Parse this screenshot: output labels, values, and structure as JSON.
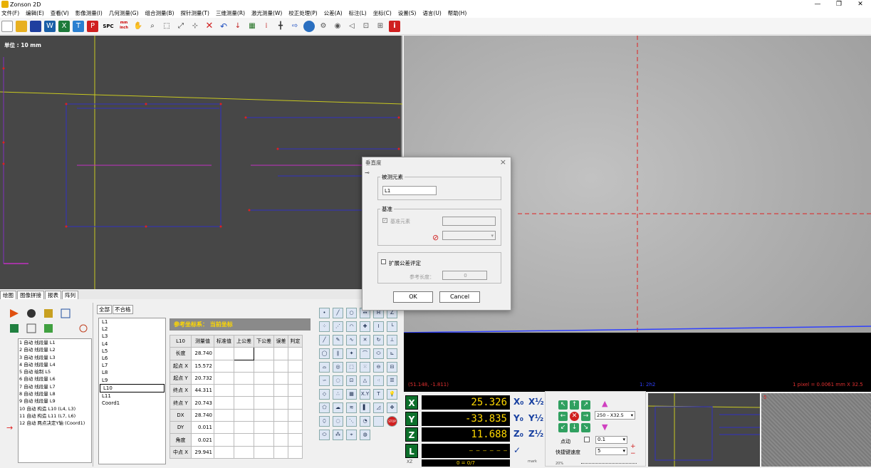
{
  "app": {
    "title": "Zonson 2D",
    "minimize": "—",
    "maximize": "❐",
    "close": "✕"
  },
  "menu": [
    "文件(F)",
    "编辑(E)",
    "查看(V)",
    "影像测量(I)",
    "几何测量(G)",
    "组合测量(B)",
    "探针测量(T)",
    "三维测量(R)",
    "激光测量(W)",
    "校正处理(P)",
    "公差(A)",
    "标注(L)",
    "坐标(C)",
    "设置(S)",
    "语言(U)",
    "帮助(H)"
  ],
  "toolbar": {
    "spc": "SPC",
    "mm_inch": "mm inch"
  },
  "left_view": {
    "unit": "单位 : 10 mm"
  },
  "camera": {
    "coord_readout": "(51.148, -1.811)",
    "blue_text": "1: 2h2",
    "pixel_readout": "1 pixel = 0.0061 mm   X 32.5"
  },
  "tabs": [
    "绘图",
    "图像拼接",
    "报表",
    "阵列"
  ],
  "program": {
    "steps": [
      "1 自动 线段量 L1",
      "2 自动 线段量 L2",
      "3 自动 线段量 L3",
      "4 自动 线段量 L4",
      "5 自动 绘制 L5",
      "6 自动 线段量 L6",
      "7 自动 线段量 L7",
      "8 自动 线段量 L8",
      "9 自动 线段量 L9",
      "10 自动 构造 L10 (L4, L3)",
      "11 自动 构造 L11 (L7, L6)",
      "12 自动 两点决定Y轴 (Coord1)"
    ]
  },
  "elements": {
    "tabs": [
      "全部",
      "不合格"
    ],
    "items": [
      "L1",
      "L2",
      "L3",
      "L4",
      "L5",
      "L6",
      "L7",
      "L8",
      "L9",
      "L10",
      "L11",
      "Coord1"
    ],
    "selected": "L10"
  },
  "measure": {
    "ref_label": "参考坐标系：   当前坐标",
    "element": "L10",
    "headers": [
      "测量值",
      "标准值",
      "上公差",
      "下公差",
      "误差",
      "判定"
    ],
    "rows": [
      {
        "name": "长度",
        "value": "28.740"
      },
      {
        "name": "起点 X",
        "value": "15.572"
      },
      {
        "name": "起点 Y",
        "value": "20.732"
      },
      {
        "name": "终点 X",
        "value": "44.311"
      },
      {
        "name": "终点 Y",
        "value": "20.743"
      },
      {
        "name": "DX",
        "value": "28.740"
      },
      {
        "name": "DY",
        "value": "0.011"
      },
      {
        "name": "角度",
        "value": "0.021"
      },
      {
        "name": "中点 X",
        "value": "29.941"
      }
    ]
  },
  "tools": {
    "xy": "X.Y",
    "stop": "STOP"
  },
  "dro": [
    {
      "axis": "X",
      "value": "25.326",
      "b1": "X₀",
      "b2": "X½"
    },
    {
      "axis": "Y",
      "value": "-33.835",
      "b1": "Y₀",
      "b2": "Y½"
    },
    {
      "axis": "Z",
      "value": "11.688",
      "b1": "Z₀",
      "b2": "Z½"
    },
    {
      "axis": "L",
      "value": "— — — — — —",
      "b1": "✓",
      "b2": ""
    }
  ],
  "dro_extra": {
    "label": "XZ",
    "value": "0 = 0/7",
    "label2": "mark"
  },
  "jog": {
    "zoom": "250 - X32.5",
    "step_label": "点动",
    "step_value": "0.1",
    "speed_label": "快捷键速度",
    "speed_value": "5",
    "bottom_label": "20%"
  },
  "dialog": {
    "title": "垂直度",
    "measured_group": "被测元素",
    "measured_value": "L1",
    "datum_group": "基准",
    "datum_checkbox": "基准元素",
    "expand_label": "扩展公差评定",
    "ref_len_label": "参考长度：",
    "ref_len_value": "0",
    "ok": "OK",
    "cancel": "Cancel"
  },
  "mini": {
    "label": "5"
  },
  "colors": {
    "yellow": "#ffd800",
    "green_axis": "#0d6f2b",
    "accent_red": "#e02020"
  }
}
